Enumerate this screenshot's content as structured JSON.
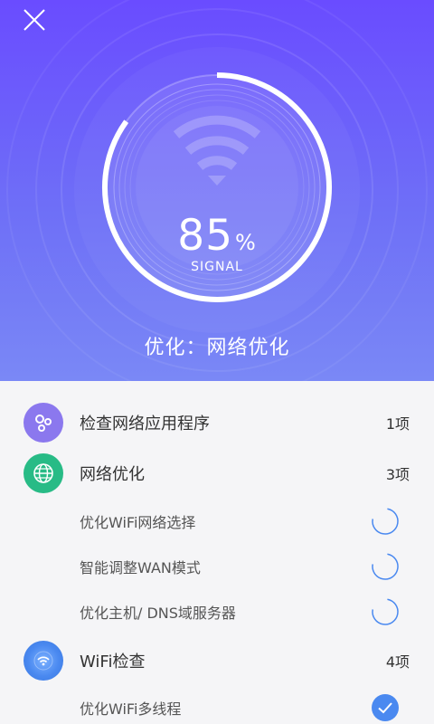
{
  "header": {
    "close_icon": "close-icon"
  },
  "gauge": {
    "value": "85",
    "unit": "%",
    "label": "SIGNAL",
    "progress": 0.85
  },
  "status_text": "优化：网络优化",
  "categories": [
    {
      "label": "检查网络应用程序",
      "count": "1项",
      "icon": "apps-icon",
      "color": "#8b78ee"
    },
    {
      "label": "网络优化",
      "count": "3项",
      "icon": "globe-icon",
      "color": "#28bb86"
    },
    {
      "label": "WiFi检查",
      "count": "4项",
      "icon": "wifi-icon",
      "color": "#4a89f0"
    }
  ],
  "items": [
    {
      "label": "优化WiFi网络选择",
      "state": "loading"
    },
    {
      "label": "智能调整WAN模式",
      "state": "loading"
    },
    {
      "label": "优化主机/ DNS域服务器",
      "state": "loading"
    },
    {
      "label": "优化WiFi多线程",
      "state": "done"
    }
  ],
  "colors": {
    "accent": "#4a89f0",
    "hero_top": "#6a4cff",
    "hero_bottom": "#7a88f6"
  }
}
